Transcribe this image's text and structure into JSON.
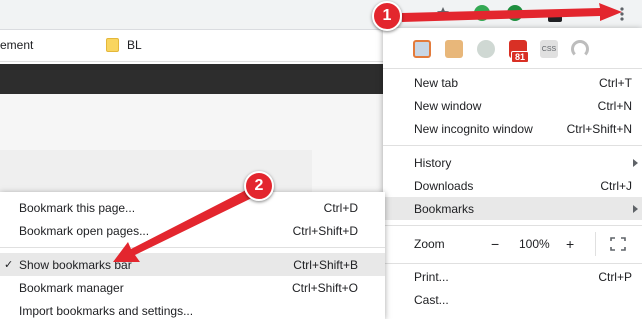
{
  "bookmarks_bar": {
    "item1": "ement",
    "item2": "BL"
  },
  "toolbar": {
    "star_icon": "star-icon",
    "menu_icon": "kebab-menu-icon"
  },
  "chrome_menu": {
    "ext_badge": "81",
    "ext_css_label": "CSS",
    "new_tab": {
      "label": "New tab",
      "shortcut": "Ctrl+T"
    },
    "new_window": {
      "label": "New window",
      "shortcut": "Ctrl+N"
    },
    "new_incognito": {
      "label": "New incognito window",
      "shortcut": "Ctrl+Shift+N"
    },
    "history": {
      "label": "History"
    },
    "downloads": {
      "label": "Downloads",
      "shortcut": "Ctrl+J"
    },
    "bookmarks": {
      "label": "Bookmarks"
    },
    "zoom": {
      "label": "Zoom",
      "minus": "−",
      "value": "100%",
      "plus": "+"
    },
    "print": {
      "label": "Print...",
      "shortcut": "Ctrl+P"
    },
    "cast": {
      "label": "Cast..."
    }
  },
  "bookmarks_submenu": {
    "bookmark_page": {
      "label": "Bookmark this page...",
      "shortcut": "Ctrl+D"
    },
    "bookmark_open": {
      "label": "Bookmark open pages...",
      "shortcut": "Ctrl+Shift+D"
    },
    "show_bar": {
      "label": "Show bookmarks bar",
      "shortcut": "Ctrl+Shift+B",
      "check": "✓"
    },
    "manager": {
      "label": "Bookmark manager",
      "shortcut": "Ctrl+Shift+O"
    },
    "import": {
      "label": "Import bookmarks and settings..."
    }
  },
  "callouts": {
    "one": "1",
    "two": "2"
  },
  "colors": {
    "callout_red": "#e3262e",
    "highlight": "#e8e8e8"
  }
}
